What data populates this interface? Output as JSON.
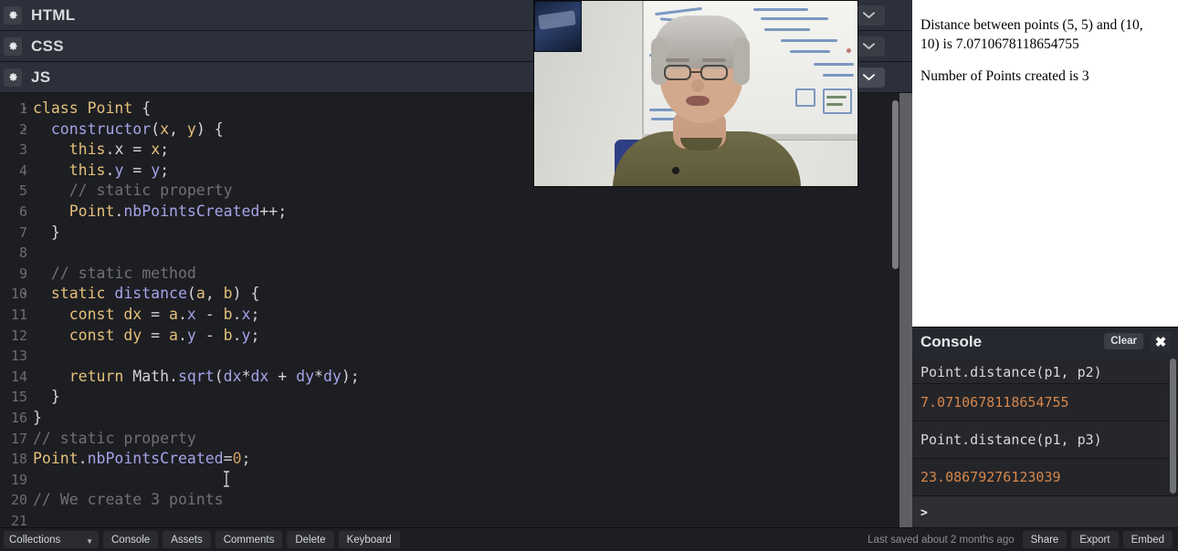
{
  "editor_panes": [
    {
      "label": "HTML",
      "gear_icon": "gear-icon",
      "collapse_icon": "chevron-down-icon",
      "active": false
    },
    {
      "label": "CSS",
      "gear_icon": "gear-icon",
      "collapse_icon": "chevron-down-icon",
      "active": false
    },
    {
      "label": "JS",
      "gear_icon": "gear-icon",
      "collapse_icon": "chevron-down-icon",
      "active": true
    }
  ],
  "code": {
    "language": "javascript",
    "lines": [
      {
        "n": "1",
        "fold": "▾",
        "tokens": [
          {
            "t": "class ",
            "c": "t-kw"
          },
          {
            "t": "Point",
            "c": "t-kw"
          },
          {
            "t": " {",
            "c": "t-punc"
          }
        ]
      },
      {
        "n": "2",
        "fold": "▾",
        "tokens": [
          {
            "t": "  ",
            "c": "t-plain"
          },
          {
            "t": "constructor",
            "c": "t-fn"
          },
          {
            "t": "(",
            "c": "t-punc"
          },
          {
            "t": "x",
            "c": "t-var"
          },
          {
            "t": ", ",
            "c": "t-punc"
          },
          {
            "t": "y",
            "c": "t-var"
          },
          {
            "t": ") {",
            "c": "t-punc"
          }
        ]
      },
      {
        "n": "3",
        "fold": "",
        "tokens": [
          {
            "t": "    ",
            "c": "t-plain"
          },
          {
            "t": "this",
            "c": "t-kw"
          },
          {
            "t": ".",
            "c": "t-punc"
          },
          {
            "t": "x",
            "c": "t-plain"
          },
          {
            "t": " = ",
            "c": "t-punc"
          },
          {
            "t": "x",
            "c": "t-var"
          },
          {
            "t": ";",
            "c": "t-punc"
          }
        ]
      },
      {
        "n": "4",
        "fold": "",
        "tokens": [
          {
            "t": "    ",
            "c": "t-plain"
          },
          {
            "t": "this",
            "c": "t-kw"
          },
          {
            "t": ".",
            "c": "t-punc"
          },
          {
            "t": "y",
            "c": "t-prop"
          },
          {
            "t": " = ",
            "c": "t-punc"
          },
          {
            "t": "y",
            "c": "t-prop"
          },
          {
            "t": ";",
            "c": "t-punc"
          }
        ]
      },
      {
        "n": "5",
        "fold": "",
        "tokens": [
          {
            "t": "    // static property",
            "c": "t-com"
          }
        ]
      },
      {
        "n": "6",
        "fold": "",
        "tokens": [
          {
            "t": "    ",
            "c": "t-plain"
          },
          {
            "t": "Point",
            "c": "t-kw"
          },
          {
            "t": ".",
            "c": "t-punc"
          },
          {
            "t": "nbPointsCreated",
            "c": "t-prop"
          },
          {
            "t": "++;",
            "c": "t-punc"
          }
        ]
      },
      {
        "n": "7",
        "fold": "",
        "tokens": [
          {
            "t": "  }",
            "c": "t-punc"
          }
        ]
      },
      {
        "n": "8",
        "fold": "",
        "tokens": [
          {
            "t": "",
            "c": "t-plain"
          }
        ]
      },
      {
        "n": "9",
        "fold": "",
        "tokens": [
          {
            "t": "  // static method",
            "c": "t-com"
          }
        ]
      },
      {
        "n": "10",
        "fold": "▾",
        "tokens": [
          {
            "t": "  ",
            "c": "t-plain"
          },
          {
            "t": "static ",
            "c": "t-kw"
          },
          {
            "t": "distance",
            "c": "t-fn"
          },
          {
            "t": "(",
            "c": "t-punc"
          },
          {
            "t": "a",
            "c": "t-var"
          },
          {
            "t": ", ",
            "c": "t-punc"
          },
          {
            "t": "b",
            "c": "t-var"
          },
          {
            "t": ") {",
            "c": "t-punc"
          }
        ]
      },
      {
        "n": "11",
        "fold": "",
        "tokens": [
          {
            "t": "    ",
            "c": "t-plain"
          },
          {
            "t": "const ",
            "c": "t-kw"
          },
          {
            "t": "dx",
            "c": "t-var"
          },
          {
            "t": " = ",
            "c": "t-punc"
          },
          {
            "t": "a",
            "c": "t-var"
          },
          {
            "t": ".",
            "c": "t-punc"
          },
          {
            "t": "x",
            "c": "t-prop"
          },
          {
            "t": " - ",
            "c": "t-punc"
          },
          {
            "t": "b",
            "c": "t-var"
          },
          {
            "t": ".",
            "c": "t-punc"
          },
          {
            "t": "x",
            "c": "t-prop"
          },
          {
            "t": ";",
            "c": "t-punc"
          }
        ]
      },
      {
        "n": "12",
        "fold": "",
        "tokens": [
          {
            "t": "    ",
            "c": "t-plain"
          },
          {
            "t": "const ",
            "c": "t-kw"
          },
          {
            "t": "dy",
            "c": "t-var"
          },
          {
            "t": " = ",
            "c": "t-punc"
          },
          {
            "t": "a",
            "c": "t-var"
          },
          {
            "t": ".",
            "c": "t-punc"
          },
          {
            "t": "y",
            "c": "t-prop"
          },
          {
            "t": " - ",
            "c": "t-punc"
          },
          {
            "t": "b",
            "c": "t-var"
          },
          {
            "t": ".",
            "c": "t-punc"
          },
          {
            "t": "y",
            "c": "t-prop"
          },
          {
            "t": ";",
            "c": "t-punc"
          }
        ]
      },
      {
        "n": "13",
        "fold": "",
        "tokens": [
          {
            "t": "",
            "c": "t-plain"
          }
        ]
      },
      {
        "n": "14",
        "fold": "",
        "tokens": [
          {
            "t": "    ",
            "c": "t-plain"
          },
          {
            "t": "return ",
            "c": "t-kw"
          },
          {
            "t": "Math",
            "c": "t-plain"
          },
          {
            "t": ".",
            "c": "t-punc"
          },
          {
            "t": "sqrt",
            "c": "t-fn"
          },
          {
            "t": "(",
            "c": "t-punc"
          },
          {
            "t": "dx",
            "c": "t-prop"
          },
          {
            "t": "*",
            "c": "t-punc"
          },
          {
            "t": "dx",
            "c": "t-prop"
          },
          {
            "t": " + ",
            "c": "t-punc"
          },
          {
            "t": "dy",
            "c": "t-prop"
          },
          {
            "t": "*",
            "c": "t-punc"
          },
          {
            "t": "dy",
            "c": "t-prop"
          },
          {
            "t": ");",
            "c": "t-punc"
          }
        ]
      },
      {
        "n": "15",
        "fold": "",
        "tokens": [
          {
            "t": "  }",
            "c": "t-punc"
          }
        ]
      },
      {
        "n": "16",
        "fold": "",
        "tokens": [
          {
            "t": "}",
            "c": "t-punc"
          }
        ]
      },
      {
        "n": "17",
        "fold": "",
        "tokens": [
          {
            "t": "// static property",
            "c": "t-com"
          }
        ]
      },
      {
        "n": "18",
        "fold": "",
        "tokens": [
          {
            "t": "Point",
            "c": "t-kw"
          },
          {
            "t": ".",
            "c": "t-punc"
          },
          {
            "t": "nbPointsCreated",
            "c": "t-prop"
          },
          {
            "t": "=",
            "c": "t-punc"
          },
          {
            "t": "0",
            "c": "t-num"
          },
          {
            "t": ";",
            "c": "t-punc"
          }
        ]
      },
      {
        "n": "19",
        "fold": "",
        "tokens": [
          {
            "t": "",
            "c": "t-plain"
          }
        ]
      },
      {
        "n": "20",
        "fold": "",
        "tokens": [
          {
            "t": "// We create 3 points",
            "c": "t-com"
          }
        ]
      },
      {
        "n": "21",
        "fold": "",
        "tokens": [
          {
            "t": "",
            "c": "t-plain"
          }
        ]
      }
    ]
  },
  "webcam": {
    "description": "presenter-webcam-overlay"
  },
  "preview": {
    "line1": "Distance between points (5, 5) and (10, 10) is 7.0710678118654755",
    "line2": "Number of Points created is 3"
  },
  "console": {
    "title": "Console",
    "clear_label": "Clear",
    "close_icon": "close-icon",
    "rows": [
      {
        "kind": "cmd",
        "text": "Point.distance(p1, p2)"
      },
      {
        "kind": "val",
        "text": "7.0710678118654755"
      },
      {
        "kind": "cmd",
        "text": "Point.distance(p1, p3)"
      },
      {
        "kind": "val",
        "text": "23.08679276123039"
      },
      {
        "kind": "prompt",
        "text": ">"
      }
    ],
    "value_color": "#d6864a"
  },
  "bottombar": {
    "collections_label": "Collections",
    "collections_caret": "caret-down-icon",
    "buttons": [
      "Console",
      "Assets",
      "Comments",
      "Delete",
      "Keyboard"
    ],
    "saved_text": "Last saved about 2 months ago",
    "right_buttons": [
      "Share",
      "Export",
      "Embed"
    ]
  }
}
